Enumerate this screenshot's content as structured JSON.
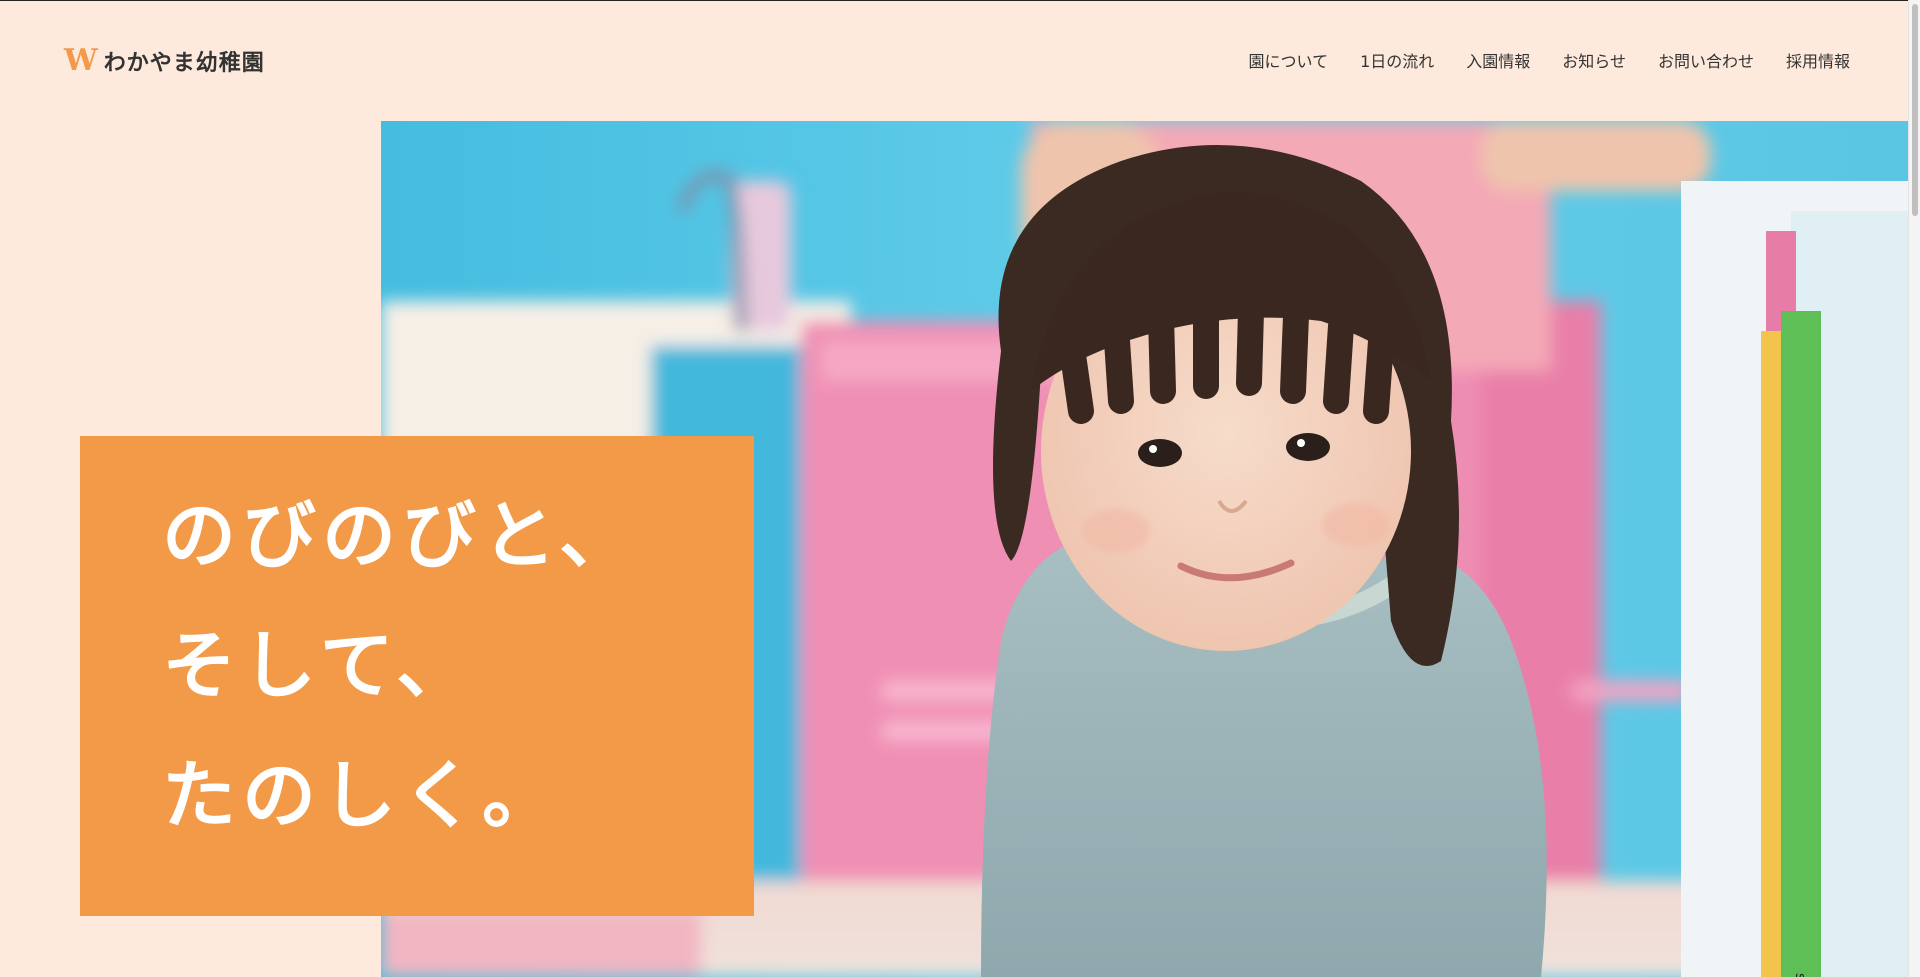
{
  "header": {
    "logo_mark": "W",
    "logo_text": "わかやま幼稚園",
    "nav": [
      {
        "label": "園について",
        "name": "nav-about"
      },
      {
        "label": "1日の流れ",
        "name": "nav-daily-flow"
      },
      {
        "label": "入園情報",
        "name": "nav-admission"
      },
      {
        "label": "お知らせ",
        "name": "nav-news"
      },
      {
        "label": "お問い合わせ",
        "name": "nav-contact"
      },
      {
        "label": "採用情報",
        "name": "nav-recruit"
      }
    ]
  },
  "hero": {
    "catch": [
      "のびのびと、",
      "そして、",
      "たのしく。"
    ],
    "photo_text": "scra"
  },
  "colors": {
    "background": "#fdeadc",
    "accent": "#f39a48",
    "text": "#333333",
    "logo_mark": "#f2994a"
  },
  "icons": {
    "logo": "w-letter-mark"
  }
}
